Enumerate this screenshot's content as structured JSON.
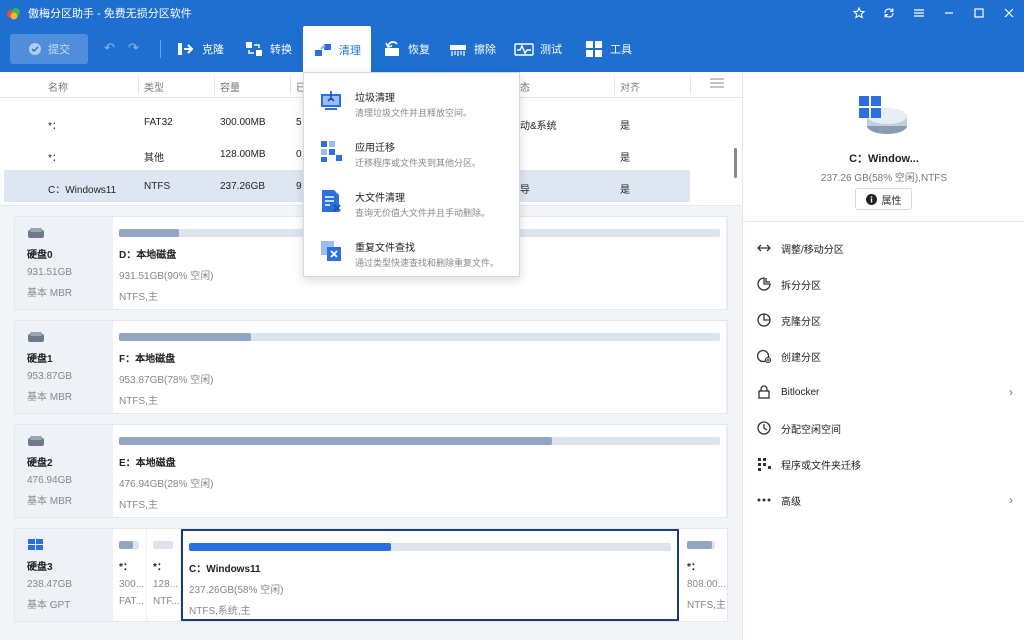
{
  "window": {
    "title": "傲梅分区助手 - 免费无损分区软件"
  },
  "toolbar": {
    "commit_label": "提交",
    "items": [
      {
        "label": "克隆",
        "icon": "clone-icon"
      },
      {
        "label": "转换",
        "icon": "convert-icon"
      },
      {
        "label": "清理",
        "icon": "clean-icon"
      },
      {
        "label": "恢复",
        "icon": "recover-icon"
      },
      {
        "label": "擦除",
        "icon": "wipe-icon"
      },
      {
        "label": "测试",
        "icon": "test-icon"
      },
      {
        "label": "工具",
        "icon": "tools-icon"
      }
    ],
    "active": "清理"
  },
  "table": {
    "headers": [
      "名称",
      "类型",
      "容量",
      "已",
      "态",
      "对齐"
    ],
    "rows": [
      {
        "name": "*：",
        "type": "FAT32",
        "capacity": "300.00MB",
        "used": "5",
        "status": "动&系统",
        "align": "是",
        "selected": false
      },
      {
        "name": "*：",
        "type": "其他",
        "capacity": "128.00MB",
        "used": "0",
        "status": "",
        "align": "是",
        "selected": false
      },
      {
        "name": "C：Windows11",
        "type": "NTFS",
        "capacity": "237.26GB",
        "used": "9",
        "status": "导",
        "align": "是",
        "selected": true
      }
    ]
  },
  "clean_menu": {
    "items": [
      {
        "title": "垃圾清理",
        "desc": "清理垃圾文件并且释放空间。",
        "icon": "junk-clean-icon"
      },
      {
        "title": "应用迁移",
        "desc": "迁移程序或文件夹到其他分区。",
        "icon": "app-mover-icon"
      },
      {
        "title": "大文件清理",
        "desc": "查询无价值大文件并且手动删除。",
        "icon": "large-file-icon"
      },
      {
        "title": "重复文件查找",
        "desc": "通过类型快速查找和删除重复文件。",
        "icon": "duplicate-file-icon"
      }
    ]
  },
  "disks": [
    {
      "name": "硬盘0",
      "size": "931.51GB",
      "style": "基本 MBR",
      "partitions": [
        {
          "name": "D：本地磁盘",
          "detail": "931.51GB(90% 空闲)",
          "fs": "NTFS,主",
          "used_fraction": 0.1
        }
      ]
    },
    {
      "name": "硬盘1",
      "size": "953.87GB",
      "style": "基本 MBR",
      "partitions": [
        {
          "name": "F：本地磁盘",
          "detail": "953.87GB(78% 空闲)",
          "fs": "NTFS,主",
          "used_fraction": 0.22
        }
      ]
    },
    {
      "name": "硬盘2",
      "size": "476.94GB",
      "style": "基本 MBR",
      "partitions": [
        {
          "name": "E：本地磁盘",
          "detail": "476.94GB(28% 空闲)",
          "fs": "NTFS,主",
          "used_fraction": 0.72
        }
      ]
    },
    {
      "name": "硬盘3",
      "size": "238.47GB",
      "style": "基本 GPT",
      "partitions": [
        {
          "name": "*：",
          "detail": "300...",
          "fs": "FAT...",
          "used_fraction": 0.7
        },
        {
          "name": "*：",
          "detail": "128...",
          "fs": "NTF...",
          "used_fraction": 0.0
        },
        {
          "name": "C：Windows11",
          "detail": "237.26GB(58% 空闲)",
          "fs": "NTFS,系统,主",
          "used_fraction": 0.42
        },
        {
          "name": "*：",
          "detail": "808.00...",
          "fs": "NTFS,主",
          "used_fraction": 0.9
        }
      ]
    }
  ],
  "sidebar": {
    "selected_name": "C：Window...",
    "selected_detail": "237.26 GB(58% 空闲),NTFS",
    "properties_label": "属性",
    "operations": [
      {
        "label": "调整/移动分区",
        "icon": "resize-icon",
        "has_submenu": false
      },
      {
        "label": "拆分分区",
        "icon": "split-icon",
        "has_submenu": false
      },
      {
        "label": "克隆分区",
        "icon": "clone-partition-icon",
        "has_submenu": false
      },
      {
        "label": "创建分区",
        "icon": "create-partition-icon",
        "has_submenu": false
      },
      {
        "label": "Bitlocker",
        "icon": "lock-icon",
        "has_submenu": true
      },
      {
        "label": "分配空闲空间",
        "icon": "allocate-icon",
        "has_submenu": false
      },
      {
        "label": "程序或文件夹迁移",
        "icon": "migrate-icon",
        "has_submenu": false
      },
      {
        "label": "高级",
        "icon": "more-icon",
        "has_submenu": true
      }
    ]
  },
  "colors": {
    "accent": "#1f6fd1",
    "bar_fill": "#93a5c4",
    "selected_fill": "#2b6fe0"
  }
}
